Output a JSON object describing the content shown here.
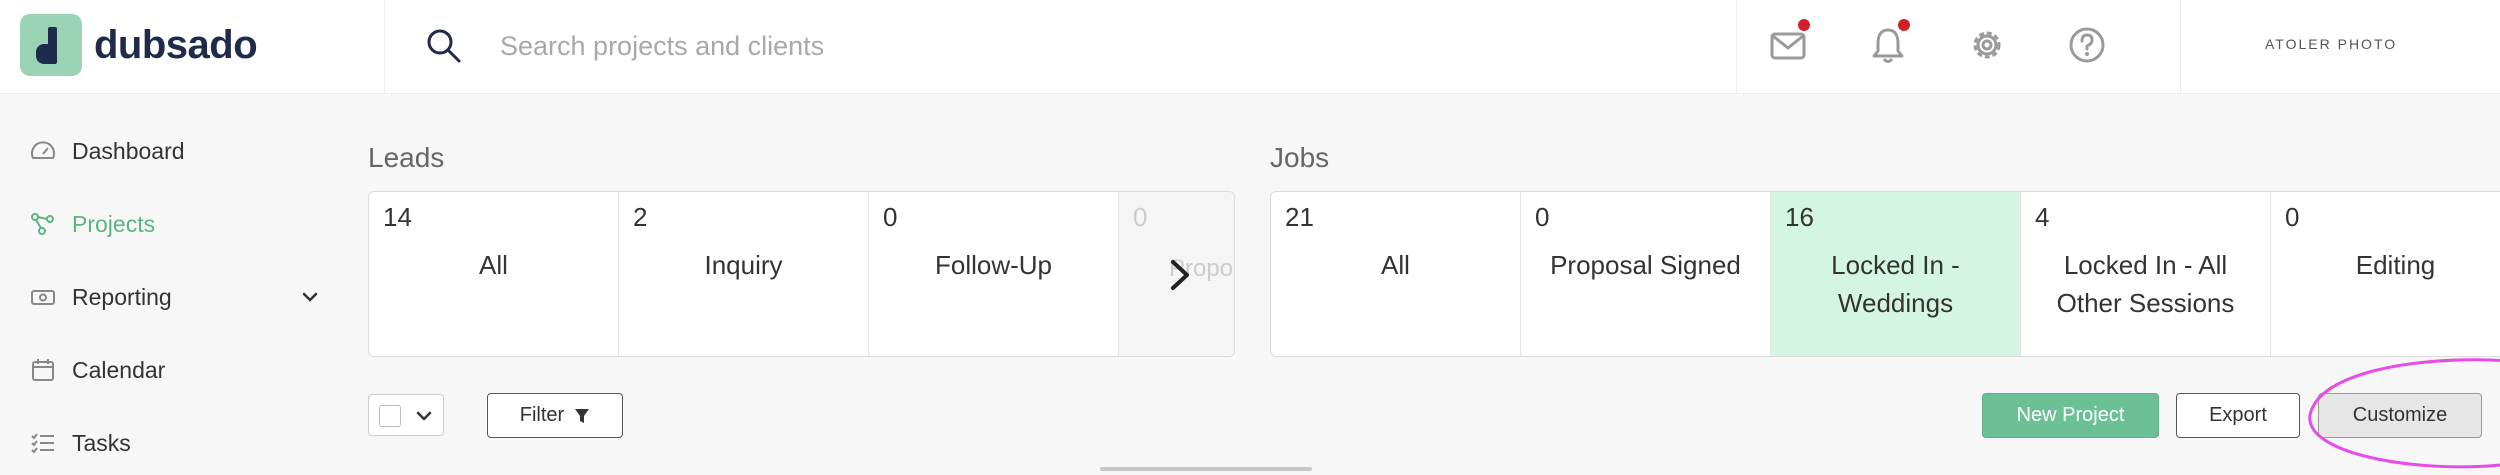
{
  "app": {
    "name": "dubsado"
  },
  "search": {
    "placeholder": "Search projects and clients"
  },
  "account": {
    "name": "ATOLER PHOTO"
  },
  "header_icons": [
    "mail-icon",
    "bell-icon",
    "gear-icon",
    "help-icon"
  ],
  "sidebar": {
    "items": [
      {
        "label": "Dashboard",
        "icon": "speedometer-icon"
      },
      {
        "label": "Projects",
        "icon": "projects-icon",
        "active": true
      },
      {
        "label": "Reporting",
        "icon": "reporting-icon"
      },
      {
        "label": "Calendar",
        "icon": "calendar-icon"
      },
      {
        "label": "Tasks",
        "icon": "tasks-icon"
      }
    ]
  },
  "leads": {
    "title": "Leads",
    "stats": [
      {
        "count": "14",
        "label": "All"
      },
      {
        "count": "2",
        "label": "Inquiry"
      },
      {
        "count": "0",
        "label": "Follow-Up"
      },
      {
        "count": "0",
        "label": "Propo"
      }
    ]
  },
  "jobs": {
    "title": "Jobs",
    "stats": [
      {
        "count": "21",
        "label": "All"
      },
      {
        "count": "0",
        "label": "Proposal Signed"
      },
      {
        "count": "16",
        "label": "Locked In - Weddings",
        "selected": true
      },
      {
        "count": "4",
        "label": "Locked In - All Other Sessions"
      },
      {
        "count": "0",
        "label": "Editing"
      }
    ]
  },
  "toolbar": {
    "filter_label": "Filter",
    "new_project_label": "New Project",
    "export_label": "Export",
    "customize_label": "Customize"
  },
  "colors": {
    "brand_navy": "#1e2b4a",
    "brand_green": "#9bd3b5",
    "accent_green": "#5cb383",
    "selected_bg": "#d4f5e3",
    "badge_red": "#d0212b",
    "annotation_magenta": "#e64ce6"
  }
}
